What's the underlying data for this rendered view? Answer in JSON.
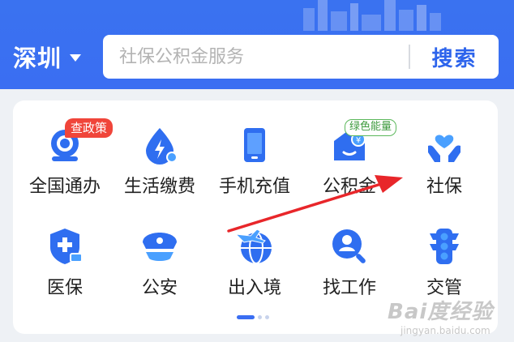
{
  "header": {
    "city": "深圳",
    "search_placeholder": "社保公积金服务",
    "search_button": "搜索"
  },
  "services": {
    "row1": [
      {
        "label": "全国通办",
        "icon": "national-service-icon",
        "badge": "查政策"
      },
      {
        "label": "生活缴费",
        "icon": "utility-payment-icon"
      },
      {
        "label": "手机充值",
        "icon": "phone-recharge-icon"
      },
      {
        "label": "公积金",
        "icon": "housing-fund-icon",
        "badge": "绿色能量"
      },
      {
        "label": "社保",
        "icon": "social-security-icon"
      }
    ],
    "row2": [
      {
        "label": "医保",
        "icon": "medical-insurance-icon"
      },
      {
        "label": "公安",
        "icon": "police-icon"
      },
      {
        "label": "出入境",
        "icon": "immigration-icon"
      },
      {
        "label": "找工作",
        "icon": "job-search-icon"
      },
      {
        "label": "交管",
        "icon": "traffic-icon"
      }
    ]
  },
  "watermark": {
    "main": "Bai度经验",
    "sub": "jingyan.baidu.com"
  },
  "colors": {
    "brand": "#3a6ef2",
    "icon_blue": "#2f6ef0",
    "badge_red": "#f0453a",
    "badge_green": "#5cb85c",
    "annotation_red": "#e8262a"
  }
}
